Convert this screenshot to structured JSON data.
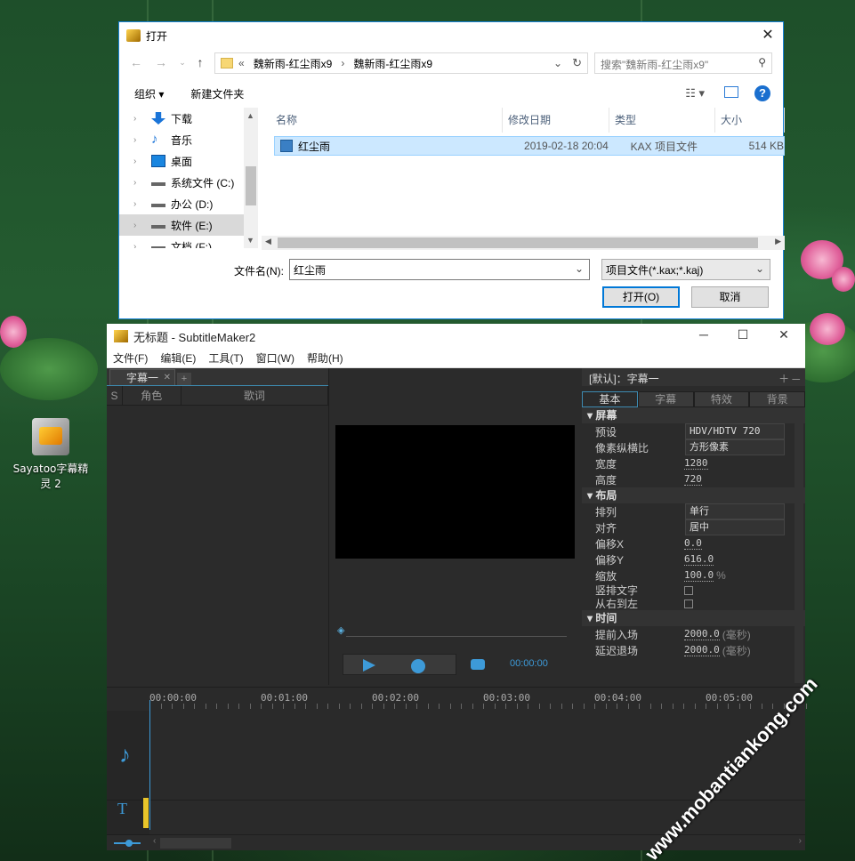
{
  "desktop": {
    "icon_label": "Sayatoo字幕精灵 2",
    "watermark": "www.mobantiankong.com"
  },
  "dialog": {
    "title": "打开",
    "address": {
      "crumbs": [
        "魏新雨-红尘雨x9",
        "魏新雨-红尘雨x9"
      ],
      "prefix": "«"
    },
    "search_placeholder": "搜索\"魏新雨-红尘雨x9\"",
    "toolbar": {
      "organize": "组织 ▾",
      "new_folder": "新建文件夹"
    },
    "tree": [
      {
        "label": "下载",
        "icon": "download-icon",
        "color": "#1a74d8"
      },
      {
        "label": "音乐",
        "icon": "music-icon",
        "color": "#1a74d8"
      },
      {
        "label": "桌面",
        "icon": "desktop-icon",
        "color": "#1a86e0"
      },
      {
        "label": "系统文件 (C:)",
        "icon": "drive-icon",
        "color": "#666666"
      },
      {
        "label": "办公 (D:)",
        "icon": "drive-icon",
        "color": "#666666"
      },
      {
        "label": "软件 (E:)",
        "icon": "drive-icon",
        "color": "#666666"
      },
      {
        "label": "文档 (F:)",
        "icon": "drive-icon",
        "color": "#666666"
      }
    ],
    "columns": [
      "名称",
      "修改日期",
      "类型",
      "大小"
    ],
    "files": [
      {
        "name": "红尘雨",
        "modified": "2019-02-18 20:04",
        "type": "KAX 项目文件",
        "size": "514 KB"
      }
    ],
    "filename_label": "文件名(N):",
    "filename_value": "红尘雨",
    "filetype_value": "项目文件(*.kax;*.kaj)",
    "open_button": "打开(O)",
    "cancel_button": "取消"
  },
  "app": {
    "title": "无标题 - SubtitleMaker2",
    "menu": [
      "文件(F)",
      "编辑(E)",
      "工具(T)",
      "窗口(W)",
      "帮助(H)"
    ],
    "subtitle_tab": "字幕一",
    "subtitle_cols": [
      "S",
      "角色",
      "歌词"
    ],
    "time_display": "00:00:00",
    "preset": "[默认]：字幕一",
    "prop_tabs": [
      "基本",
      "字幕",
      "特效",
      "背景"
    ],
    "sections": {
      "screen": {
        "title": "屏幕",
        "rows": [
          {
            "k": "预设",
            "v": "HDV/HDTV 720",
            "kind": "select"
          },
          {
            "k": "像素纵横比",
            "v": "方形像素",
            "kind": "select"
          },
          {
            "k": "宽度",
            "v": "1280",
            "kind": "input"
          },
          {
            "k": "高度",
            "v": "720",
            "kind": "input"
          }
        ]
      },
      "layout": {
        "title": "布局",
        "rows": [
          {
            "k": "排列",
            "v": "单行",
            "kind": "select"
          },
          {
            "k": "对齐",
            "v": "居中",
            "kind": "select"
          },
          {
            "k": "偏移X",
            "v": "0.0",
            "kind": "input"
          },
          {
            "k": "偏移Y",
            "v": "616.0",
            "kind": "input"
          },
          {
            "k": "缩放",
            "v": "100.0",
            "unit": "%",
            "kind": "input"
          },
          {
            "k": "竖排文字",
            "kind": "check"
          },
          {
            "k": "从右到左",
            "kind": "check"
          }
        ]
      },
      "time": {
        "title": "时间",
        "rows": [
          {
            "k": "提前入场",
            "v": "2000.0",
            "unit": "(毫秒)",
            "kind": "input"
          },
          {
            "k": "延迟退场",
            "v": "2000.0",
            "unit": "(毫秒)",
            "kind": "input"
          }
        ]
      }
    },
    "ruler_labels": [
      "00:00:00",
      "00:01:00",
      "00:02:00",
      "00:03:00",
      "00:04:00",
      "00:05:00"
    ]
  }
}
